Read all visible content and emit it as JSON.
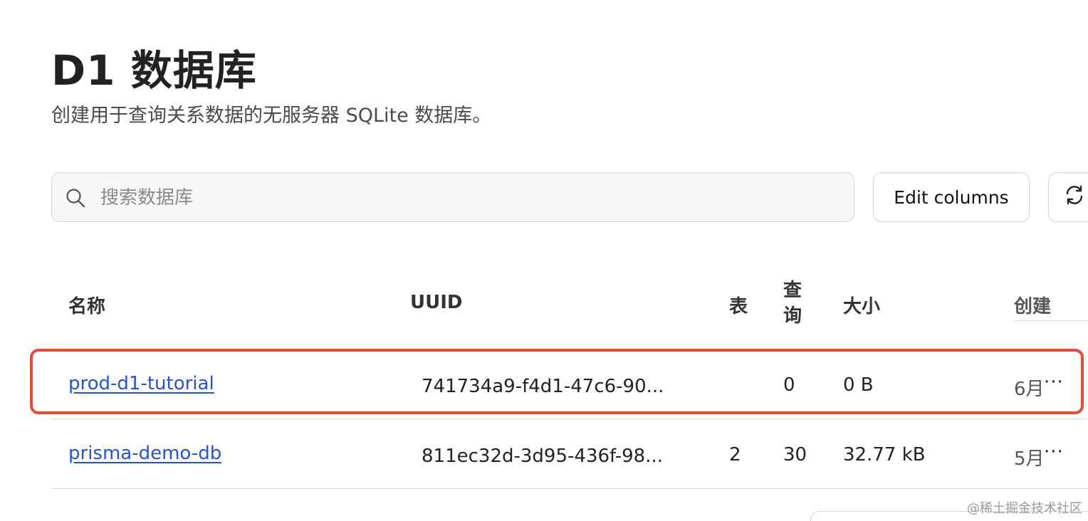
{
  "page": {
    "title": "D1 数据库",
    "subtitle": "创建用于查询关系数据的无服务器 SQLite 数据库。"
  },
  "search": {
    "placeholder": "搜索数据库",
    "value": ""
  },
  "toolbar": {
    "edit_columns_label": "Edit columns"
  },
  "table": {
    "headers": {
      "name": "名称",
      "uuid": "UUID",
      "tables": "表",
      "queries_line1": "查",
      "queries_line2": "询",
      "size": "大小",
      "created": "创建"
    },
    "rows": [
      {
        "name": "prod-d1-tutorial",
        "uuid": "741734a9-f4d1-47c6-90...",
        "tables": "",
        "queries": "0",
        "size": "0 B",
        "created": "6月"
      },
      {
        "name": "prisma-demo-db",
        "uuid": "811ec32d-3d95-436f-98...",
        "tables": "2",
        "queries": "30",
        "size": "32.77 kB",
        "created": "5月"
      }
    ],
    "more_label": "···"
  },
  "watermark": "@稀土掘金技术社区",
  "colors": {
    "link": "#2553d6",
    "highlight": "#e84a35"
  }
}
